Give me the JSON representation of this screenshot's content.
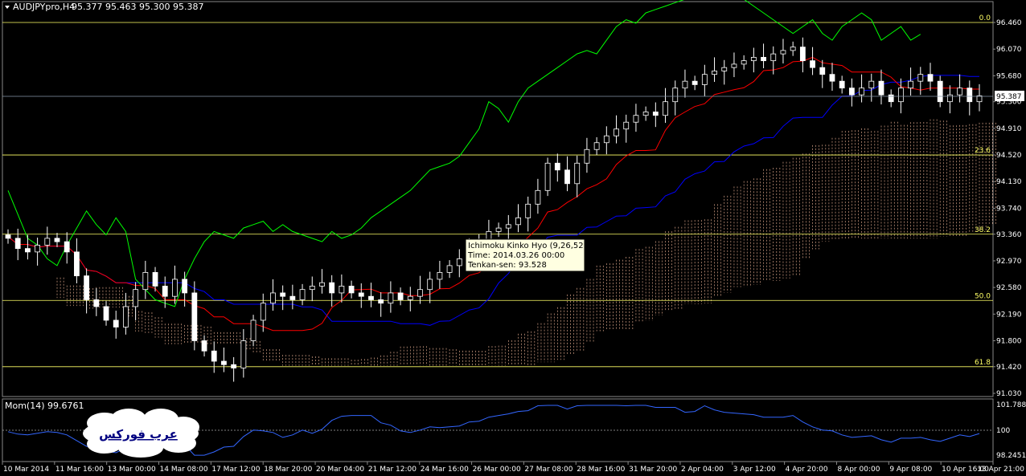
{
  "header": {
    "symbol": "AUDJPYpro,H4",
    "ohlc": "95.377 95.463 95.300 95.387"
  },
  "price_axis": [
    "96.460",
    "96.070",
    "95.680",
    "95.300",
    "94.910",
    "94.520",
    "94.130",
    "93.740",
    "93.360",
    "92.970",
    "92.580",
    "92.190",
    "91.800",
    "91.420",
    "91.030"
  ],
  "current_price": "95.387",
  "fib_levels": [
    {
      "label": "0.0",
      "price": 96.46
    },
    {
      "label": "23.6",
      "price": 94.52
    },
    {
      "label": "38.2",
      "price": 93.36
    },
    {
      "label": "50.0",
      "price": 92.39
    },
    {
      "label": "61.8",
      "price": 91.42
    }
  ],
  "tooltip": {
    "line1": "Ichimoku Kinko Hyo (9,26,52)",
    "line2": "Time: 2014.03.26 00:00",
    "line3": "Tenkan-sen: 93.528"
  },
  "momentum": {
    "label": "Mom(14) 99.6761",
    "axis": [
      "101.7888",
      "100",
      "98.2451"
    ]
  },
  "logo": {
    "text": "عرب فوركس"
  },
  "time_axis": [
    "10 Mar 2014",
    "11 Mar 16:00",
    "13 Mar 00:00",
    "14 Mar 08:00",
    "17 Mar 12:00",
    "18 Mar 20:00",
    "20 Mar 04:00",
    "21 Mar 12:00",
    "24 Mar 16:00",
    "26 Mar 00:00",
    "27 Mar 08:00",
    "28 Mar 16:00",
    "31 Mar 20:00",
    "2 Apr 04:00",
    "3 Apr 12:00",
    "4 Apr 20:00",
    "8 Apr 00:00",
    "9 Apr 08:00",
    "10 Apr 16:00",
    "13 Apr 21:00"
  ],
  "colors": {
    "bull": "#000000",
    "bull_border": "#ffffff",
    "bear": "#ffffff",
    "bear_border": "#ffffff",
    "tenkan": "#ff0000",
    "kijun": "#0000ff",
    "chikou": "#00ff00",
    "cloud_up": "#ffc0a0",
    "cloud_down": "#ffb0b0",
    "fib": "#ffff66",
    "momentum": "#3366ff"
  },
  "chart_data": {
    "type": "candlestick",
    "title": "AUDJPYpro,H4",
    "ylim": [
      91.03,
      96.46
    ],
    "closes": [
      93.3,
      93.15,
      93.1,
      93.2,
      93.3,
      93.25,
      93.1,
      92.75,
      92.4,
      92.3,
      92.1,
      92.0,
      92.3,
      92.55,
      92.8,
      92.6,
      92.45,
      92.7,
      92.5,
      91.8,
      91.65,
      91.5,
      91.45,
      91.4,
      91.8,
      92.1,
      92.35,
      92.5,
      92.45,
      92.4,
      92.55,
      92.6,
      92.65,
      92.5,
      92.6,
      92.5,
      92.45,
      92.4,
      92.35,
      92.5,
      92.4,
      92.45,
      92.55,
      92.7,
      92.8,
      92.9,
      93.0,
      93.1,
      93.25,
      93.4,
      93.45,
      93.5,
      93.6,
      93.8,
      94.0,
      94.4,
      94.3,
      94.1,
      94.4,
      94.6,
      94.7,
      94.8,
      94.9,
      95.0,
      95.1,
      95.15,
      95.1,
      95.3,
      95.5,
      95.6,
      95.55,
      95.7,
      95.75,
      95.8,
      95.85,
      95.9,
      95.95,
      95.9,
      96.0,
      96.05,
      96.1,
      95.9,
      95.8,
      95.7,
      95.6,
      95.5,
      95.4,
      95.5,
      95.6,
      95.4,
      95.3,
      95.5,
      95.6,
      95.7,
      95.6,
      95.3,
      95.4,
      95.5,
      95.3,
      95.387
    ]
  }
}
